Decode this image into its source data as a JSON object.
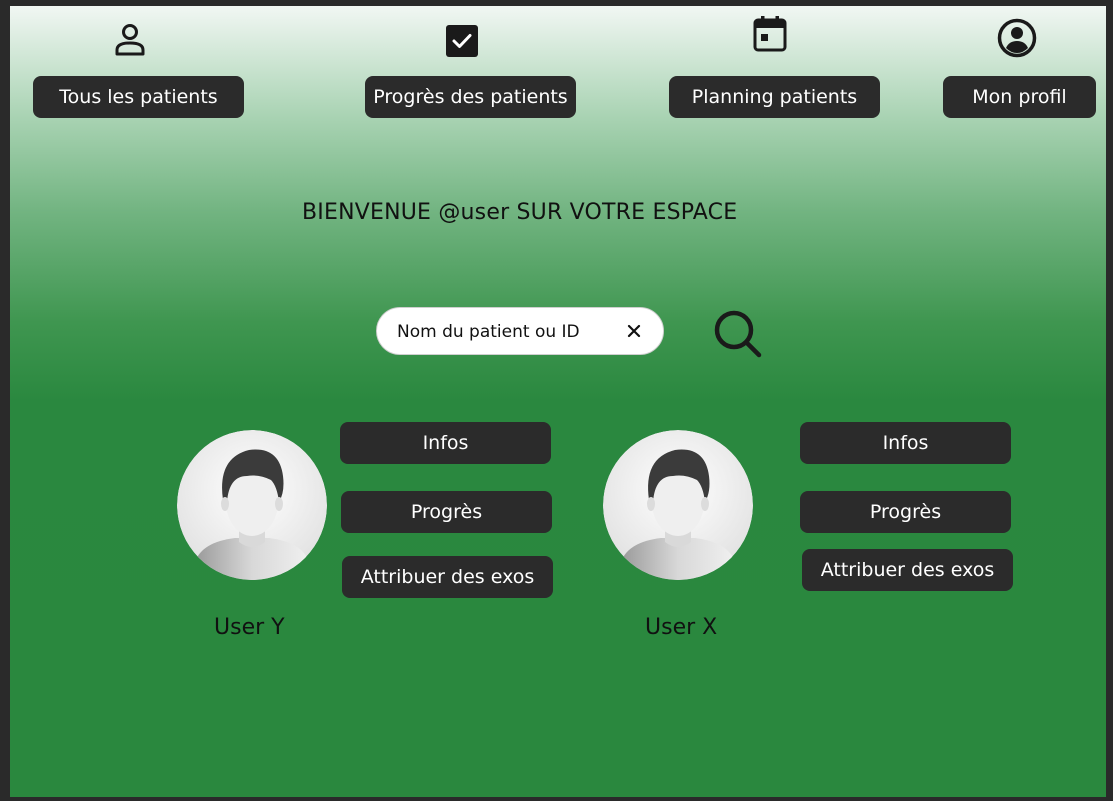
{
  "nav": {
    "items": [
      {
        "label": "Tous les patients",
        "icon": "person-icon"
      },
      {
        "label": "Progrès des patients",
        "icon": "checkbox-icon"
      },
      {
        "label": "Planning patients",
        "icon": "calendar-icon"
      },
      {
        "label": "Mon profil",
        "icon": "account-circle-icon"
      }
    ]
  },
  "welcome": "BIENVENUE @user SUR VOTRE ESPACE",
  "search": {
    "value": "Nom du patient ou ID",
    "clear_icon": "close-icon",
    "search_icon": "search-icon"
  },
  "users": [
    {
      "name": "User Y",
      "avatar_icon": "avatar-placeholder",
      "actions": [
        "Infos",
        "Progrès",
        "Attribuer des exos"
      ]
    },
    {
      "name": "User X",
      "avatar_icon": "avatar-placeholder",
      "actions": [
        "Infos",
        "Progrès",
        "Attribuer des exos"
      ]
    }
  ],
  "colors": {
    "background_top": "#f1f7f3",
    "background_bottom": "#2a883e",
    "button": "#2b2b2b",
    "button_text": "#ffffff"
  }
}
